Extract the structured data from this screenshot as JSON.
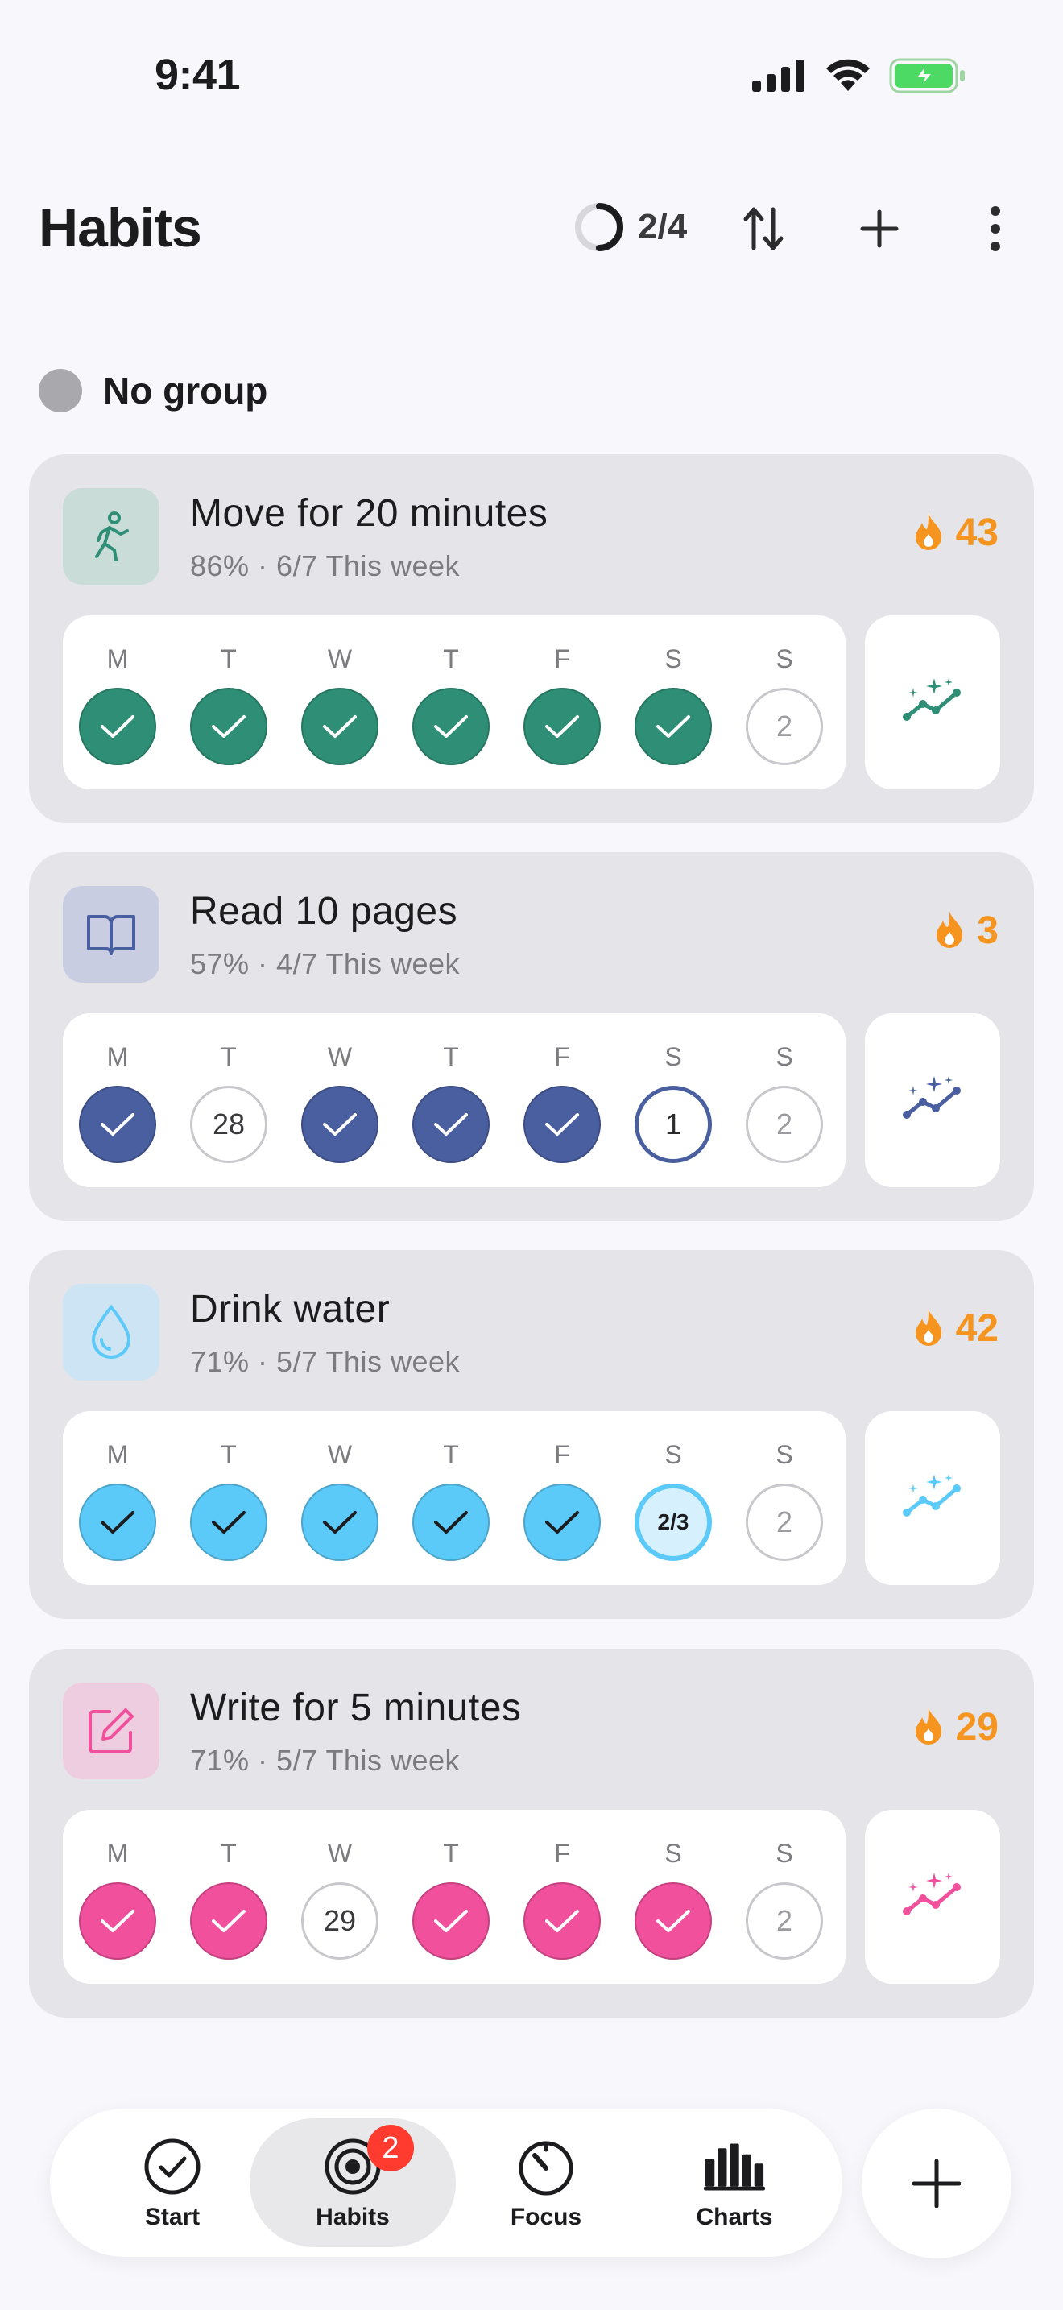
{
  "status_bar": {
    "time": "9:41"
  },
  "header": {
    "title": "Habits",
    "progress": "2/4",
    "progress_fraction": 0.5
  },
  "group": {
    "label": "No group"
  },
  "colors": {
    "move": "#2f8f76",
    "read": "#4a5fa0",
    "water": "#5ccaf8",
    "write": "#f0509c",
    "streak": "#f5941e",
    "badge": "#ff3b30"
  },
  "habits": [
    {
      "name": "Move for 20 minutes",
      "stats": "86% · 6/7 This week",
      "streak": "43",
      "icon": "running-person-icon",
      "days": [
        {
          "letter": "M",
          "state": "done"
        },
        {
          "letter": "T",
          "state": "done"
        },
        {
          "letter": "W",
          "state": "done"
        },
        {
          "letter": "T",
          "state": "done"
        },
        {
          "letter": "F",
          "state": "done"
        },
        {
          "letter": "S",
          "state": "done"
        },
        {
          "letter": "S",
          "state": "empty",
          "text": "2"
        }
      ]
    },
    {
      "name": "Read 10 pages",
      "stats": "57% · 4/7 This week",
      "streak": "3",
      "icon": "open-book-icon",
      "days": [
        {
          "letter": "M",
          "state": "done"
        },
        {
          "letter": "T",
          "state": "pending",
          "text": "28"
        },
        {
          "letter": "W",
          "state": "done"
        },
        {
          "letter": "T",
          "state": "done"
        },
        {
          "letter": "F",
          "state": "done"
        },
        {
          "letter": "S",
          "state": "today",
          "text": "1"
        },
        {
          "letter": "S",
          "state": "empty",
          "text": "2"
        }
      ]
    },
    {
      "name": "Drink water",
      "stats": "71% · 5/7 This week",
      "streak": "42",
      "icon": "water-drop-icon",
      "days": [
        {
          "letter": "M",
          "state": "done"
        },
        {
          "letter": "T",
          "state": "done"
        },
        {
          "letter": "W",
          "state": "done"
        },
        {
          "letter": "T",
          "state": "done"
        },
        {
          "letter": "F",
          "state": "done"
        },
        {
          "letter": "S",
          "state": "partial",
          "text": "2/3"
        },
        {
          "letter": "S",
          "state": "empty",
          "text": "2"
        }
      ]
    },
    {
      "name": "Write for 5 minutes",
      "stats": "71% · 5/7 This week",
      "streak": "29",
      "icon": "edit-note-icon",
      "days": [
        {
          "letter": "M",
          "state": "done"
        },
        {
          "letter": "T",
          "state": "done"
        },
        {
          "letter": "W",
          "state": "pending",
          "text": "29"
        },
        {
          "letter": "T",
          "state": "done"
        },
        {
          "letter": "F",
          "state": "done"
        },
        {
          "letter": "S",
          "state": "done"
        },
        {
          "letter": "S",
          "state": "empty",
          "text": "2"
        }
      ]
    }
  ],
  "tabbar": {
    "tabs": [
      {
        "label": "Start",
        "icon": "check-circle-icon"
      },
      {
        "label": "Habits",
        "icon": "target-icon",
        "badge": "2",
        "active": true
      },
      {
        "label": "Focus",
        "icon": "timer-icon"
      },
      {
        "label": "Charts",
        "icon": "bar-chart-icon"
      }
    ]
  }
}
